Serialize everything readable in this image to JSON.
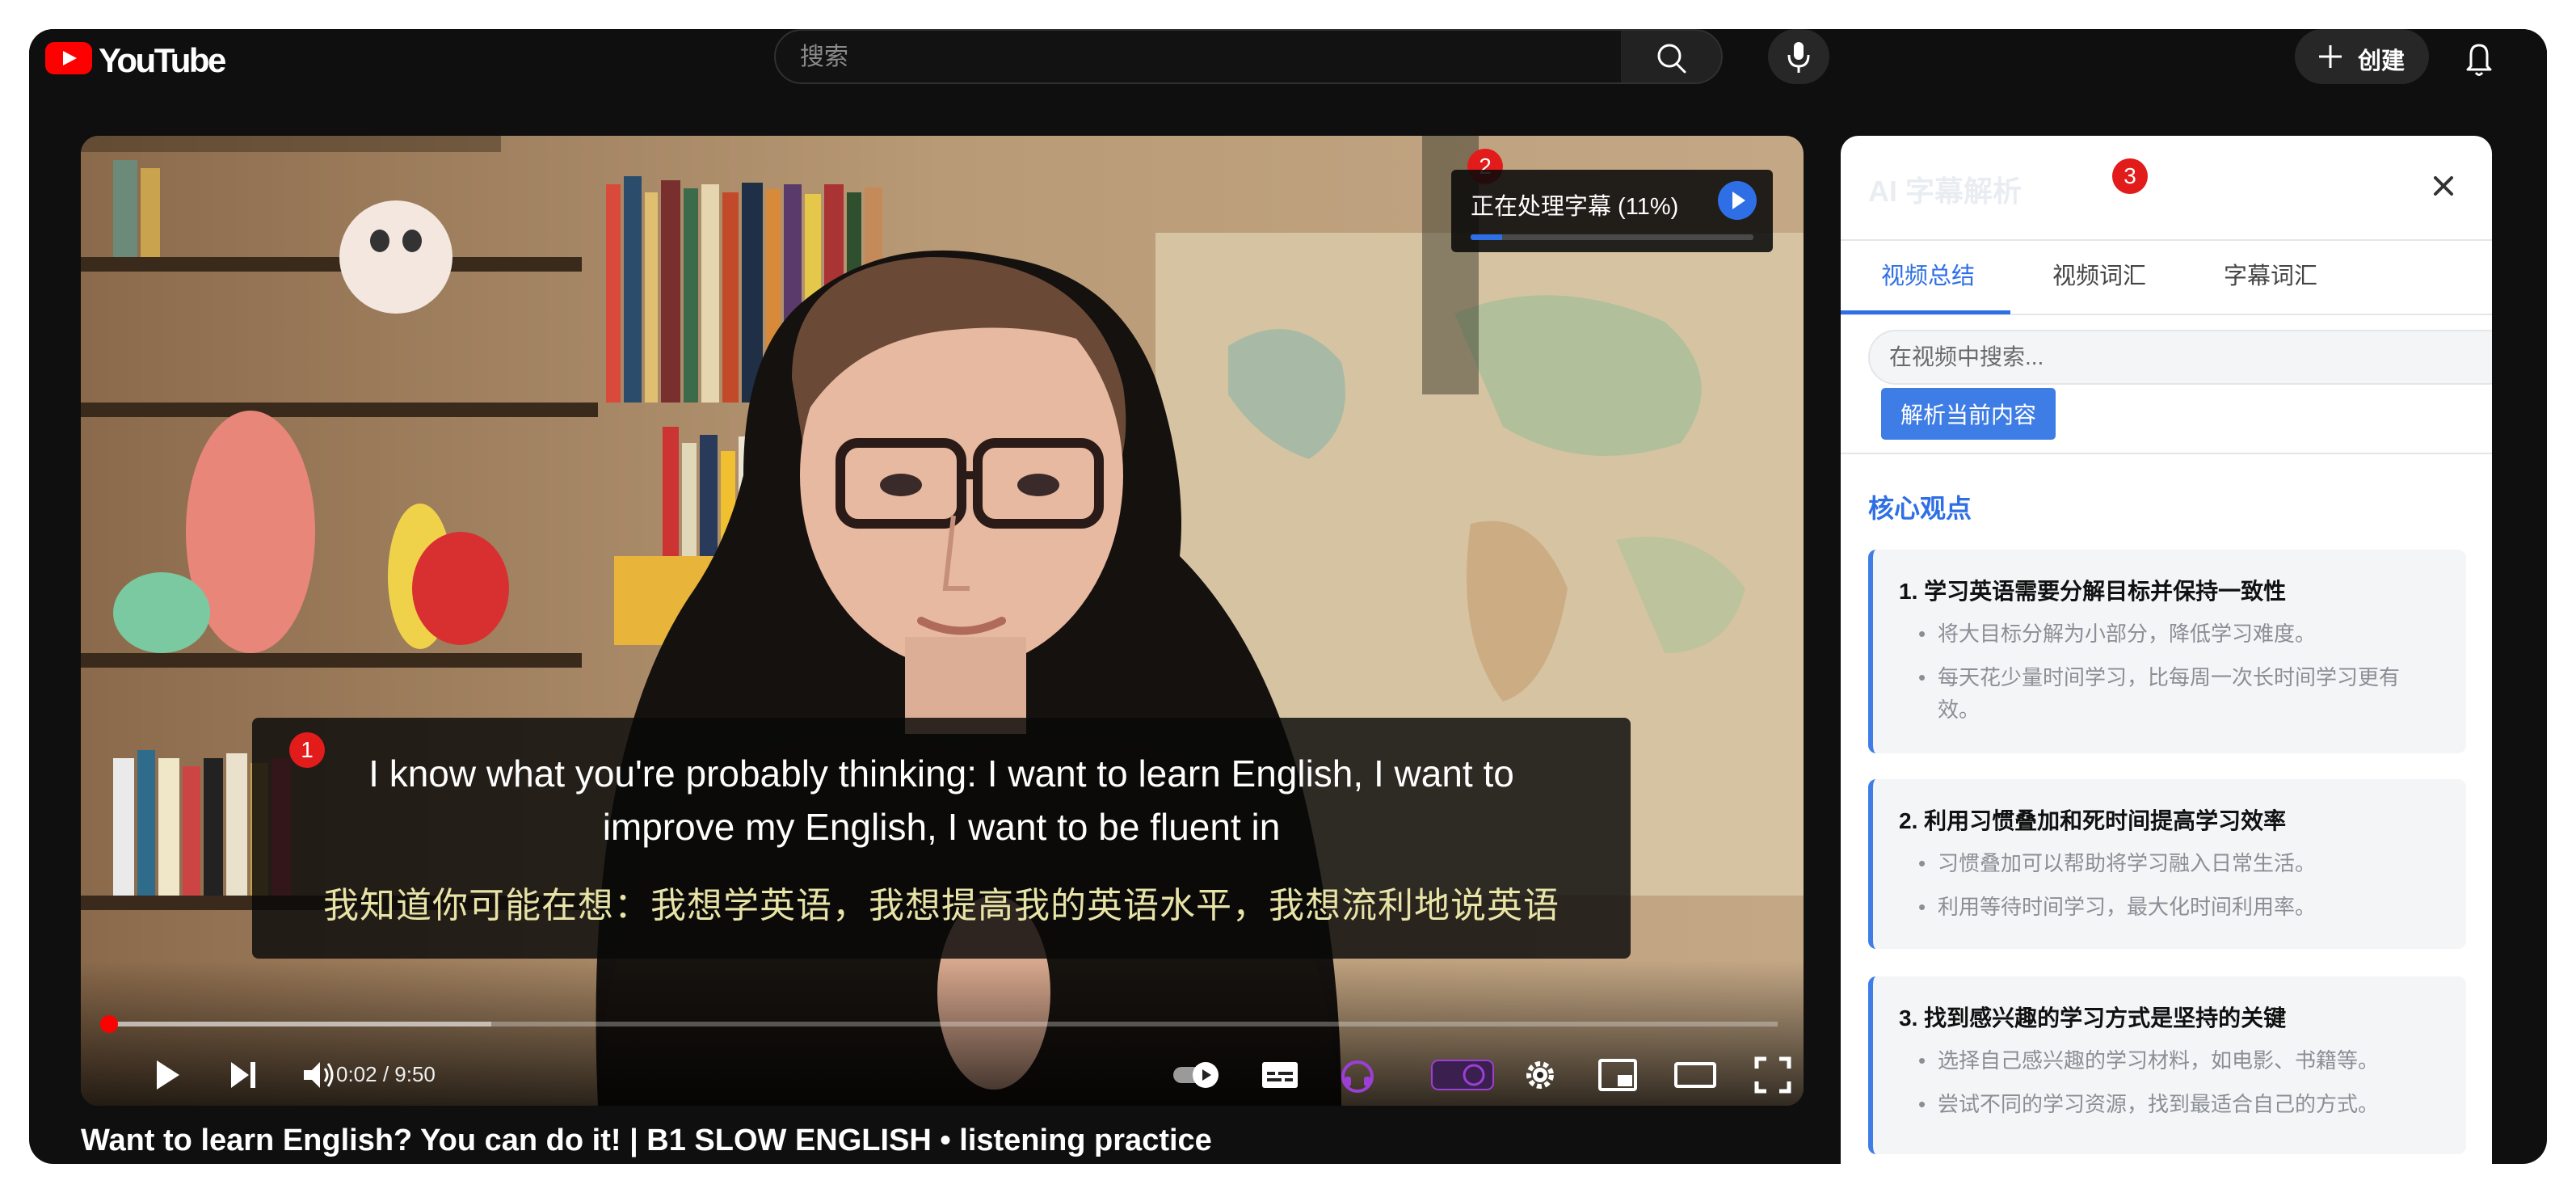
{
  "app": {
    "logo_text": "YouTube"
  },
  "search": {
    "placeholder": "搜索"
  },
  "header": {
    "create_label": "创建"
  },
  "video": {
    "title": "Want to learn English? You can do it! | B1 SLOW ENGLISH • listening practice",
    "current_time": "0:02 / 9:50",
    "played_fraction": 0.0034,
    "buffered_fraction": 0.23
  },
  "captions": {
    "badge": "1",
    "english": "I know what you're probably thinking: I want to learn English, I want to improve my English, I want to be fluent in",
    "chinese": "我知道你可能在想：我想学英语，我想提高我的英语水平，我想流利地说英语"
  },
  "processing": {
    "badge": "2",
    "label": "正在处理字幕 (11%)",
    "progress": 0.11
  },
  "panel": {
    "badge": "3",
    "title": "AI 字幕解析",
    "tabs": [
      {
        "label": "视频总结"
      },
      {
        "label": "视频词汇"
      },
      {
        "label": "字幕词汇"
      }
    ],
    "search_placeholder": "在视频中搜索...",
    "analyze_label": "解析当前内容",
    "section_title": "核心观点",
    "cards": [
      {
        "title": "1. 学习英语需要分解目标并保持一致性",
        "bullets": [
          "将大目标分解为小部分，降低学习难度。",
          "每天花少量时间学习，比每周一次长时间学习更有效。"
        ]
      },
      {
        "title": "2. 利用习惯叠加和死时间提高学习效率",
        "bullets": [
          "习惯叠加可以帮助将学习融入日常生活。",
          "利用等待时间学习，最大化时间利用率。"
        ]
      },
      {
        "title": "3. 找到感兴趣的学习方式是坚持的关键",
        "bullets": [
          "选择自己感兴趣的学习材料，如电影、书籍等。",
          "尝试不同的学习资源，找到最适合自己的方式。"
        ]
      }
    ]
  },
  "colors": {
    "accent_blue": "#2f6fe6",
    "youtube_red": "#ff0000",
    "badge_red": "#e21b1b",
    "caption_chinese": "#e8e3a6",
    "extension_purple": "#9b3fd6"
  }
}
